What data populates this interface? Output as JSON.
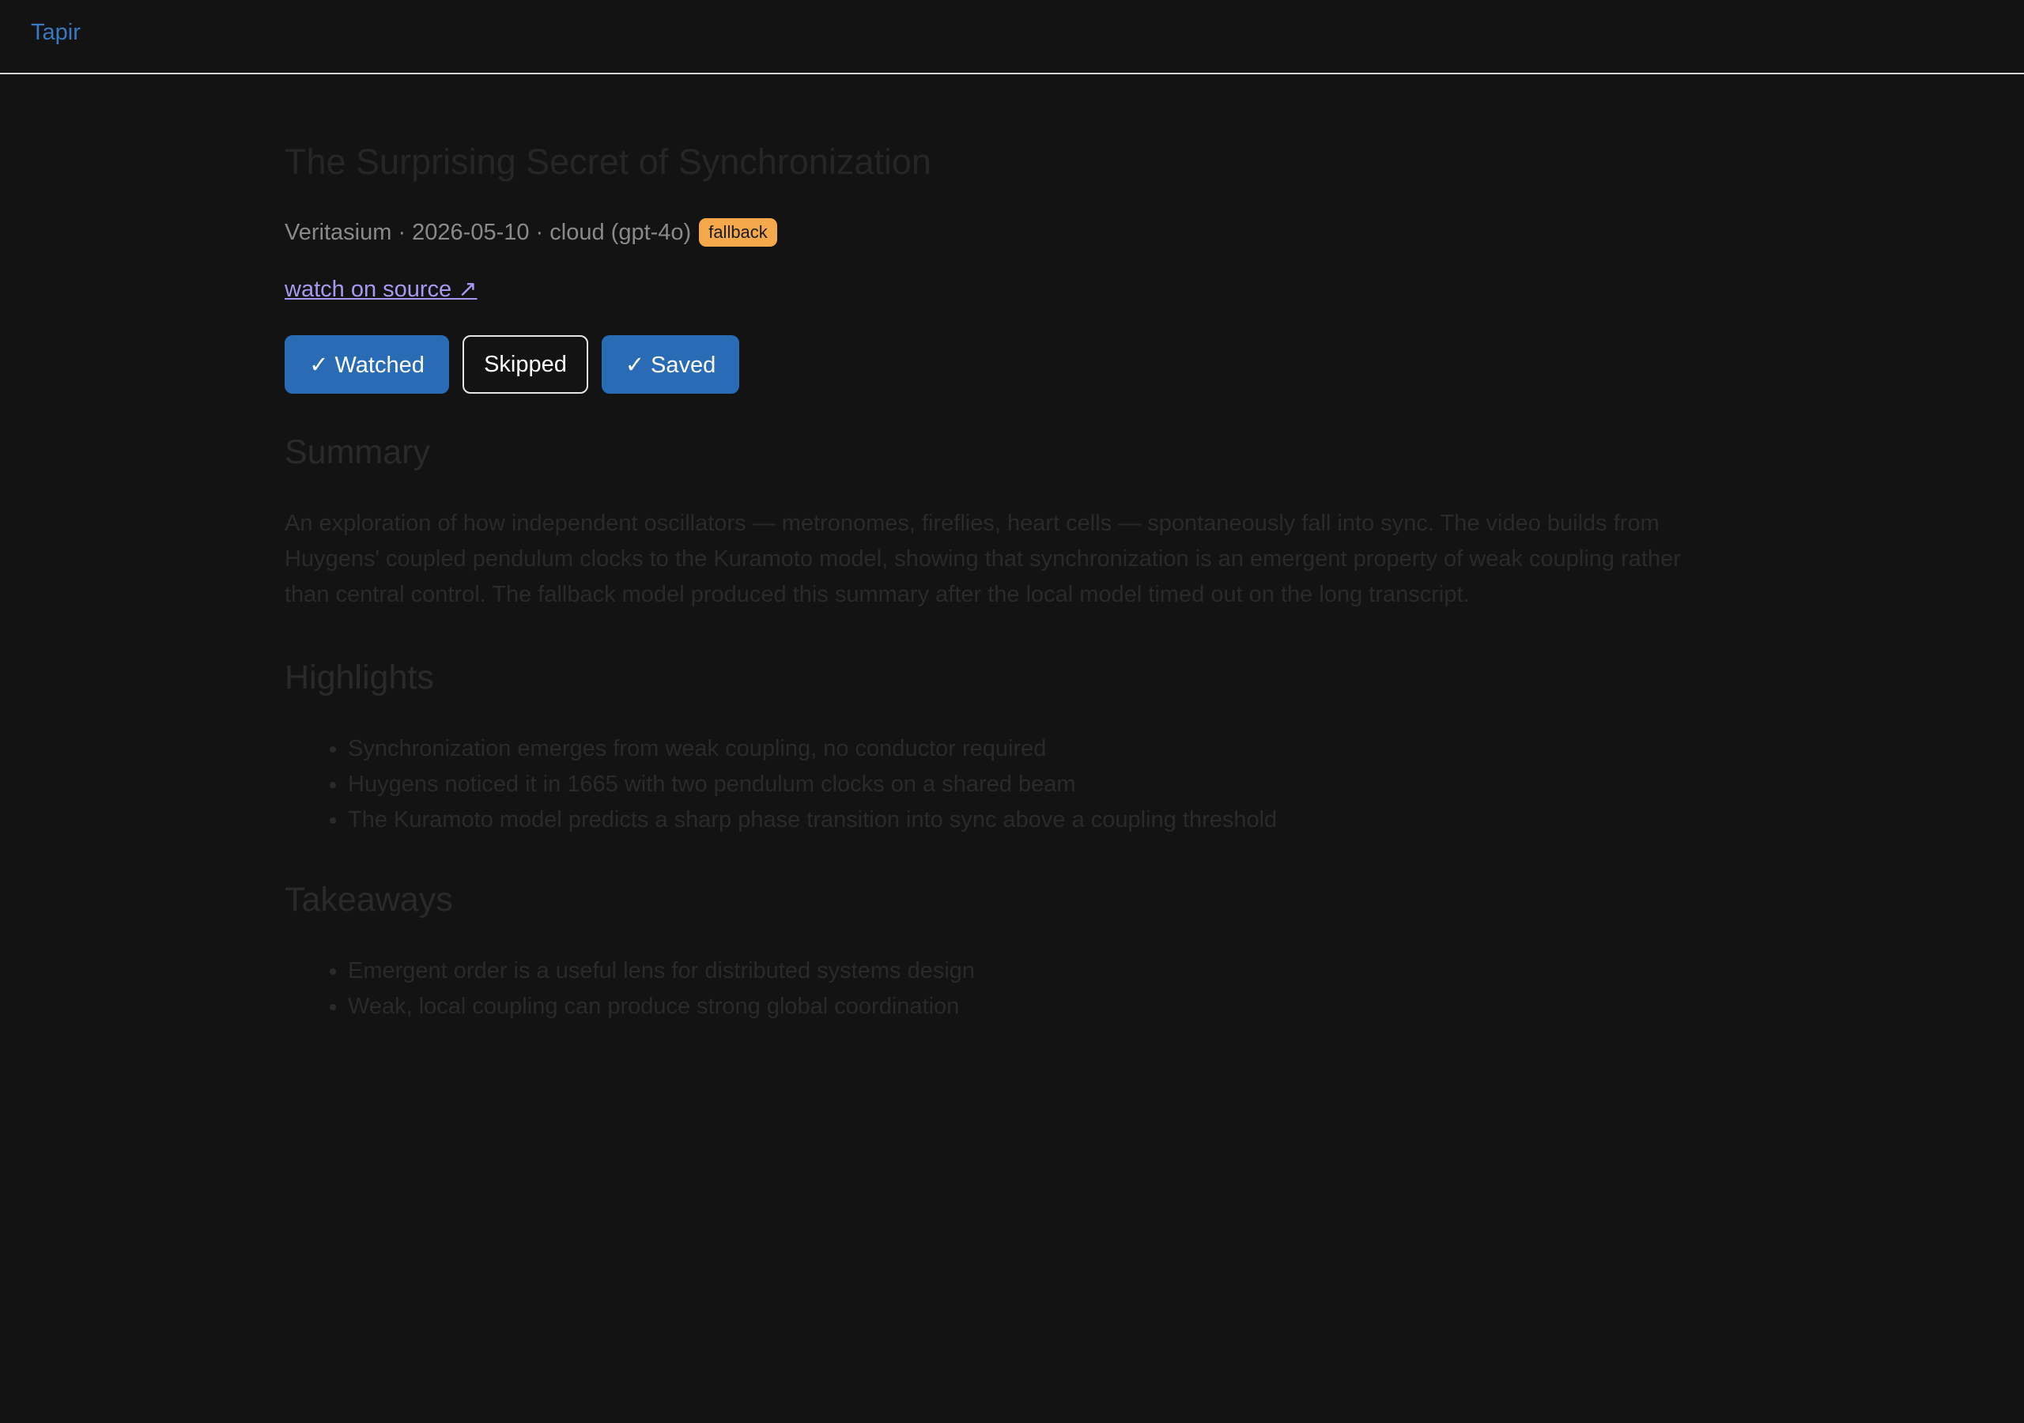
{
  "app": {
    "brand": "Tapir"
  },
  "video": {
    "title": "The Surprising Secret of Synchronization",
    "channel": "Veritasium",
    "separator": "·",
    "date": "2026-05-10",
    "model": "cloud (gpt-4o)",
    "meta_line": "Veritasium · 2026-05-10 · cloud (gpt-4o)",
    "badge": "fallback",
    "source_link": "watch on source ↗"
  },
  "actions": {
    "watched": "✓ Watched",
    "skipped": "Skipped",
    "saved": "✓ Saved",
    "colors": {
      "primary": "#2a6bb5",
      "badge": "#f5a94b",
      "link": "#a898f0",
      "brand": "#3a78c2"
    }
  },
  "summary": {
    "heading": "Summary",
    "text": "An exploration of how independent oscillators — metronomes, fireflies, heart cells — spontaneously fall into sync. The video builds from Huygens' coupled pendulum clocks to the Kuramoto model, showing that synchronization is an emergent property of weak coupling rather than central control. The fallback model produced this summary after the local model timed out on the long transcript."
  },
  "highlights": {
    "heading": "Highlights",
    "items": [
      "Synchronization emerges from weak coupling, no conductor required",
      "Huygens noticed it in 1665 with two pendulum clocks on a shared beam",
      "The Kuramoto model predicts a sharp phase transition into sync above a coupling threshold"
    ]
  },
  "takeaways": {
    "heading": "Takeaways",
    "items": [
      "Emergent order is a useful lens for distributed systems design",
      "Weak, local coupling can produce strong global coordination"
    ]
  }
}
